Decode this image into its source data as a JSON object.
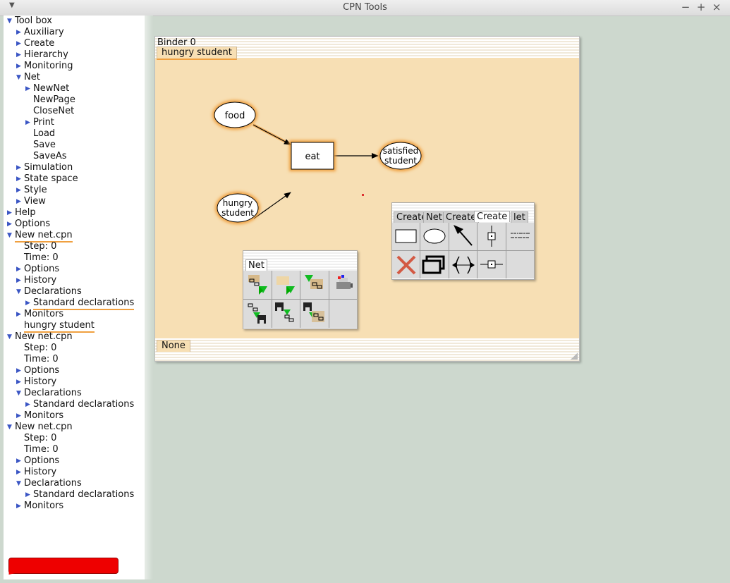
{
  "window": {
    "title": "CPN Tools",
    "menu_glyph": "▼",
    "min_glyph": "−",
    "max_glyph": "+",
    "close_glyph": "×"
  },
  "tree": [
    {
      "label": "Tool box",
      "triangle": "down"
    },
    {
      "label": "Auxiliary",
      "triangle": "right"
    },
    {
      "label": "Create",
      "triangle": "right"
    },
    {
      "label": "Hierarchy",
      "triangle": "right"
    },
    {
      "label": "Monitoring",
      "triangle": "right"
    },
    {
      "label": "Net",
      "triangle": "down"
    },
    {
      "label": "NewNet",
      "triangle": "right"
    },
    {
      "label": "NewPage",
      "triangle": ""
    },
    {
      "label": "CloseNet",
      "triangle": ""
    },
    {
      "label": "Print",
      "triangle": "right"
    },
    {
      "label": "Load",
      "triangle": ""
    },
    {
      "label": "Save",
      "triangle": ""
    },
    {
      "label": "SaveAs",
      "triangle": ""
    },
    {
      "label": "Simulation",
      "triangle": "right"
    },
    {
      "label": "State space",
      "triangle": "right"
    },
    {
      "label": "Style",
      "triangle": "right"
    },
    {
      "label": "View",
      "triangle": "right"
    },
    {
      "label": "Help",
      "triangle": "right"
    },
    {
      "label": "Options",
      "triangle": "right"
    },
    {
      "label": "New net.cpn",
      "triangle": "down",
      "underline": true
    },
    {
      "label": "Step: 0",
      "triangle": ""
    },
    {
      "label": "Time: 0",
      "triangle": ""
    },
    {
      "label": "Options",
      "triangle": "right"
    },
    {
      "label": "History",
      "triangle": "right"
    },
    {
      "label": "Declarations",
      "triangle": "down"
    },
    {
      "label": "Standard declarations",
      "triangle": "right",
      "underline": true
    },
    {
      "label": "Monitors",
      "triangle": "right"
    },
    {
      "label": "hungry student",
      "triangle": "",
      "underline": true
    },
    {
      "label": "New net.cpn",
      "triangle": "down"
    },
    {
      "label": "Step: 0",
      "triangle": ""
    },
    {
      "label": "Time: 0",
      "triangle": ""
    },
    {
      "label": "Options",
      "triangle": "right"
    },
    {
      "label": "History",
      "triangle": "right"
    },
    {
      "label": "Declarations",
      "triangle": "down"
    },
    {
      "label": "Standard declarations",
      "triangle": "right"
    },
    {
      "label": "Monitors",
      "triangle": "right"
    },
    {
      "label": "New net.cpn",
      "triangle": "down"
    },
    {
      "label": "Step: 0",
      "triangle": ""
    },
    {
      "label": "Time: 0",
      "triangle": ""
    },
    {
      "label": "Options",
      "triangle": "right"
    },
    {
      "label": "History",
      "triangle": "right"
    },
    {
      "label": "Declarations",
      "triangle": "down"
    },
    {
      "label": "Standard declarations",
      "triangle": "right"
    },
    {
      "label": "Monitors",
      "triangle": "right"
    }
  ],
  "binder": {
    "title": "Binder 0",
    "page_tab": "hungry student",
    "bottom_tab": "None"
  },
  "net": {
    "place_food": "food",
    "transition_eat": "eat",
    "place_hungry_line1": "hungry",
    "place_hungry_line2": "student",
    "place_satisfied_line1": "satisfied",
    "place_satisfied_line2": "student"
  },
  "net_palette": {
    "tab": "Net"
  },
  "create_palette": {
    "tabs": [
      "Create",
      "Net",
      "Create",
      "Create",
      "let"
    ],
    "active_tab": "Create"
  },
  "colors": {
    "page_bg": "#f7dfb4",
    "highlight": "#f0a040",
    "tree_triangle": "#3a55c4",
    "desktop": "#cdd8ce"
  }
}
